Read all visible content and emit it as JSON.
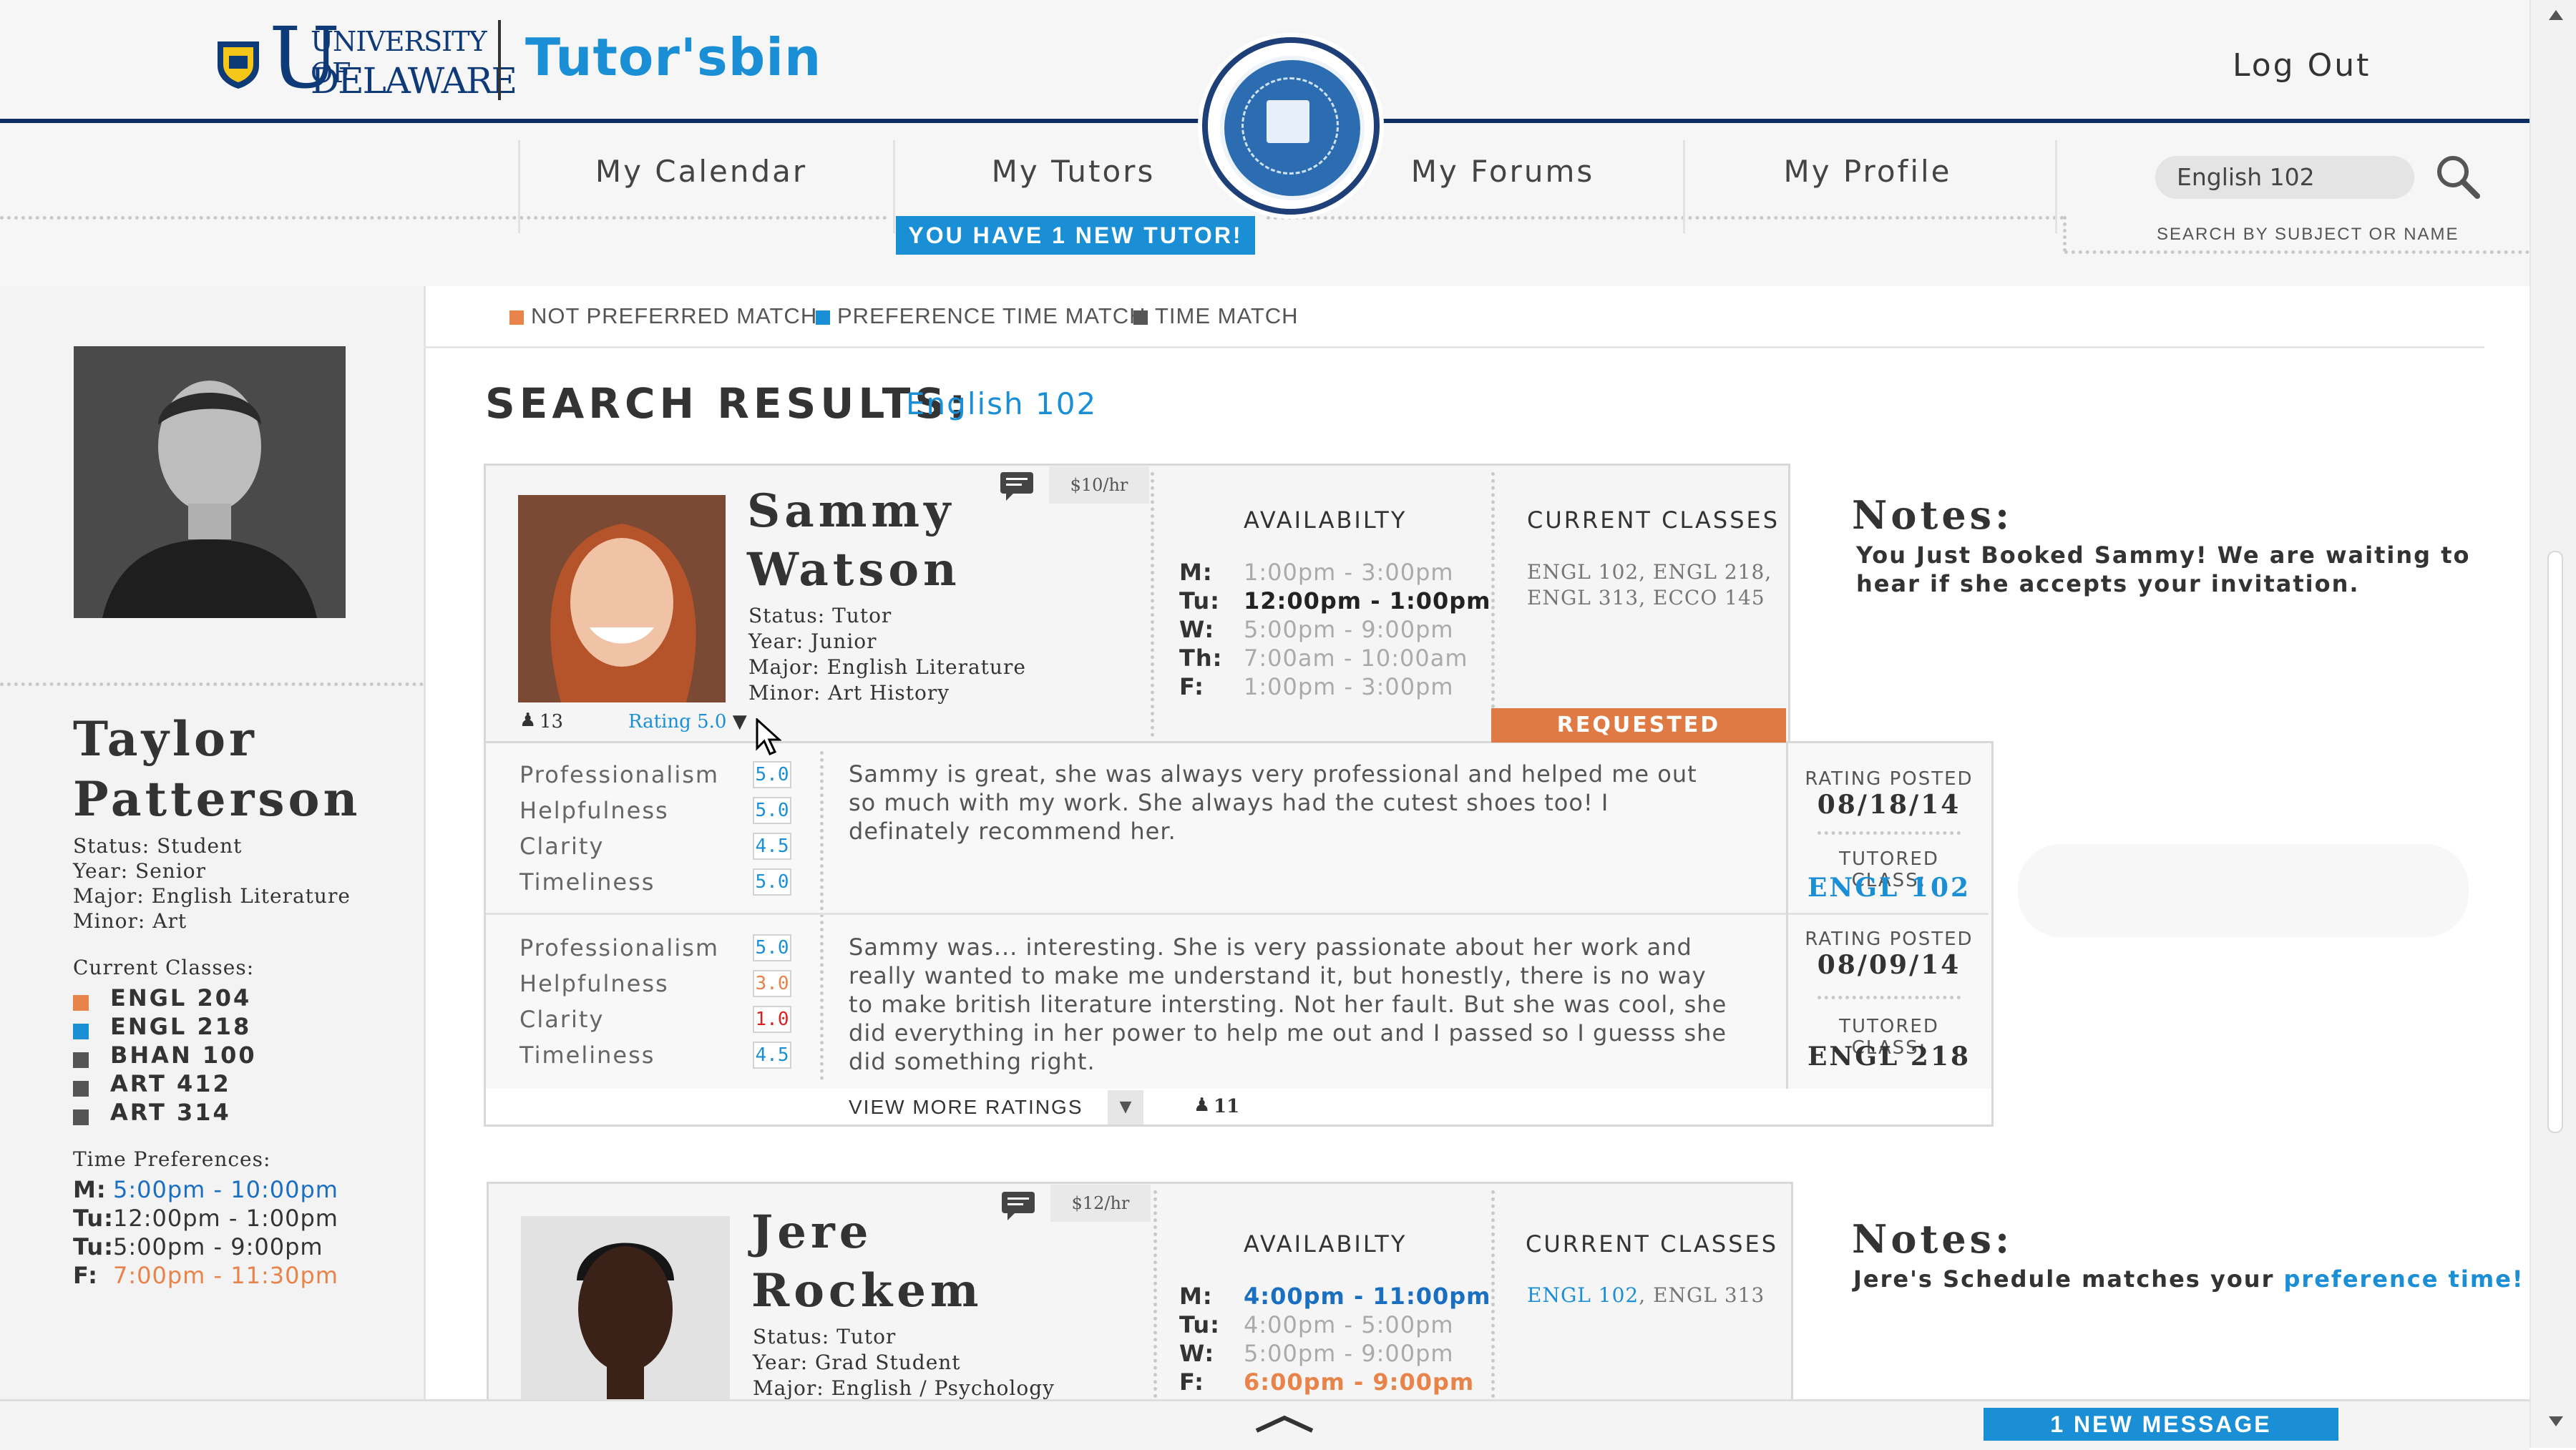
{
  "header": {
    "university_logo_line1": "UNIVERSITY OF",
    "university_logo_line2": "DELAWARE",
    "app_logo": "Tutor'sbin",
    "logout_label": "Log Out",
    "seal_icon": "university-seal-icon"
  },
  "nav": {
    "items": [
      {
        "label": "My Calendar"
      },
      {
        "label": "My Tutors"
      },
      {
        "label": "My Forums"
      },
      {
        "label": "My Profile"
      }
    ],
    "banner": "YOU HAVE 1 NEW TUTOR!"
  },
  "search": {
    "value": "English 102",
    "hint": "SEARCH BY SUBJECT OR NAME",
    "icon": "search-icon"
  },
  "legend": [
    {
      "label": "NOT PREFERRED MATCH",
      "color": "#e8834a"
    },
    {
      "label": "PREFERENCE TIME MATCH",
      "color": "#1a8fd6"
    },
    {
      "label": "TIME MATCH",
      "color": "#555555"
    }
  ],
  "profile": {
    "first_name": "Taylor",
    "last_name": "Patterson",
    "status": "Status: Student",
    "year": "Year: Senior",
    "major": "Major: English Literature",
    "minor": "Minor: Art",
    "classes_label": "Current Classes:",
    "classes": [
      {
        "name": "ENGL 204",
        "color": "#e8834a"
      },
      {
        "name": "ENGL 218",
        "color": "#1a8fd6"
      },
      {
        "name": "BHAN 100",
        "color": "#555555"
      },
      {
        "name": "ART 412",
        "color": "#555555"
      },
      {
        "name": "ART 314",
        "color": "#555555"
      }
    ],
    "time_label": "Time Preferences:",
    "times": [
      {
        "day": "M:",
        "time": "5:00pm - 10:00pm",
        "color": "#1a6fc0"
      },
      {
        "day": "Tu:",
        "time": "12:00pm - 1:00pm",
        "color": "#333333"
      },
      {
        "day": "Tu:",
        "time": "5:00pm - 9:00pm",
        "color": "#333333"
      },
      {
        "day": "F:",
        "time": "7:00pm - 11:30pm",
        "color": "#e8834a"
      }
    ]
  },
  "results": {
    "title": "SEARCH RESULTS:",
    "query": "English 102"
  },
  "tutor1": {
    "first_name": "Sammy",
    "last_name": "Watson",
    "status": "Status: Tutor",
    "year": "Year: Junior",
    "major": "Major: English Literature",
    "minor": "Minor: Art History",
    "price": "$10/hr",
    "students": "13",
    "rating": "Rating 5.0",
    "availability_label": "AVAILABILTY",
    "availability": [
      {
        "day": "M:",
        "time": "1:00pm - 3:00pm"
      },
      {
        "day": "Tu:",
        "time": "12:00pm - 1:00pm"
      },
      {
        "day": "W:",
        "time": "5:00pm - 9:00pm"
      },
      {
        "day": "Th:",
        "time": "7:00am - 10:00am"
      },
      {
        "day": "F:",
        "time": "1:00pm - 3:00pm"
      }
    ],
    "classes_label": "CURRENT CLASSES",
    "classes_line1": "ENGL 102, ENGL 218,",
    "classes_line2": "ENGL 313, ECCO 145",
    "status_badge": "REQUESTED",
    "notes_title": "Notes:",
    "notes_line1": "You Just Booked Sammy! We are waiting to",
    "notes_line2": "hear if she accepts your invitation.",
    "reviews": [
      {
        "scores": [
          {
            "label": "Professionalism",
            "value": "5.0"
          },
          {
            "label": "Helpfulness",
            "value": "5.0"
          },
          {
            "label": "Clarity",
            "value": "4.5"
          },
          {
            "label": "Timeliness",
            "value": "5.0"
          }
        ],
        "text": "Sammy is great, she was always very professional and helped me out so much with my work. She always had the cutest shoes too! I definately recommend her.",
        "posted_label": "RATING POSTED",
        "posted_date": "08/18/14",
        "class_label": "TUTORED CLASS:",
        "class": "ENGL 102"
      },
      {
        "scores": [
          {
            "label": "Professionalism",
            "value": "5.0"
          },
          {
            "label": "Helpfulness",
            "value": "3.0"
          },
          {
            "label": "Clarity",
            "value": "1.0"
          },
          {
            "label": "Timeliness",
            "value": "4.5"
          }
        ],
        "text": "Sammy was... interesting. She is very passionate about her work and really wanted to make me understand it, but honestly, there is no way to make british literature intersting. Not her fault. But she was cool, she did everything in her power to help me out and I passed so I guesss she did something right.",
        "posted_label": "RATING POSTED",
        "posted_date": "08/09/14",
        "class_label": "TUTORED CLASS:",
        "class": "ENGL 218"
      }
    ],
    "view_more": "VIEW MORE RATINGS",
    "more_count": "11"
  },
  "tutor2": {
    "first_name": "Jere",
    "last_name": "Rockem",
    "status": "Status: Tutor",
    "year": "Year: Grad Student",
    "major": "Major: English / Psychology",
    "price": "$12/hr",
    "availability_label": "AVAILABILTY",
    "availability": [
      {
        "day": "M:",
        "time": "4:00pm - 11:00pm"
      },
      {
        "day": "Tu:",
        "time": "4:00pm - 5:00pm"
      },
      {
        "day": "W:",
        "time": "5:00pm - 9:00pm"
      },
      {
        "day": "F:",
        "time": "6:00pm - 9:00pm"
      }
    ],
    "classes_label": "CURRENT CLASSES",
    "class_a": "ENGL 102",
    "class_sep": ", ",
    "class_b": "ENGL 313",
    "notes_title": "Notes:",
    "notes_text": "Jere's Schedule matches your ",
    "notes_link": "preference time!"
  },
  "footer": {
    "message": "1 NEW MESSAGE"
  }
}
